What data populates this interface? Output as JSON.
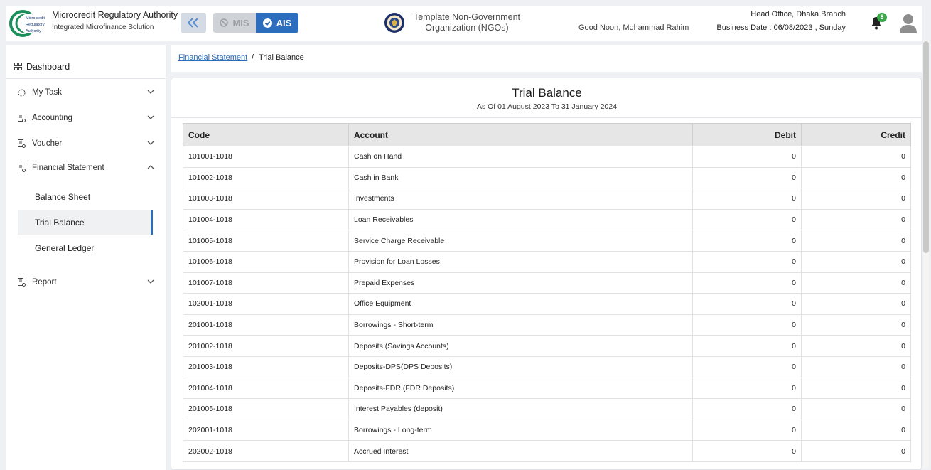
{
  "header": {
    "org_name": "Microcredit Regulatory Authority",
    "org_subtitle": "Integrated Microfinance Solution",
    "logo_text": [
      "Microcredit",
      "Regulatory",
      "Authority"
    ],
    "mis_label": "MIS",
    "ais_label": "AIS",
    "center_org": "Template Non-Government Organization (NGOs)",
    "greeting": "Good Noon, Mohammad Rahim",
    "branch": "Head Office, Dhaka Branch",
    "business_date": "Business Date : 06/08/2023 , Sunday",
    "notification_count": "8",
    "accent_color": "#2a6ebd",
    "badge_color": "#38a848"
  },
  "sidebar": {
    "dashboard": "Dashboard",
    "my_task": "My Task",
    "accounting": "Accounting",
    "voucher": "Voucher",
    "financial_statement": "Financial Statement",
    "balance_sheet": "Balance Sheet",
    "trial_balance": "Trial Balance",
    "general_ledger": "General Ledger",
    "report": "Report"
  },
  "breadcrumb": {
    "parent": "Financial Statement",
    "separator": "/",
    "current": "Trial Balance"
  },
  "report": {
    "title": "Trial Balance",
    "subtitle": "As Of 01 August 2023 To 31 January 2024",
    "columns": [
      "Code",
      "Account",
      "Debit",
      "Credit"
    ],
    "rows": [
      {
        "code": "101001-1018",
        "account": "Cash on Hand",
        "debit": "0",
        "credit": "0"
      },
      {
        "code": "101002-1018",
        "account": "Cash in Bank",
        "debit": "0",
        "credit": "0"
      },
      {
        "code": "101003-1018",
        "account": "Investments",
        "debit": "0",
        "credit": "0"
      },
      {
        "code": "101004-1018",
        "account": "Loan Receivables",
        "debit": "0",
        "credit": "0"
      },
      {
        "code": "101005-1018",
        "account": "Service Charge Receivable",
        "debit": "0",
        "credit": "0"
      },
      {
        "code": "101006-1018",
        "account": "Provision for Loan Losses",
        "debit": "0",
        "credit": "0"
      },
      {
        "code": "101007-1018",
        "account": "Prepaid Expenses",
        "debit": "0",
        "credit": "0"
      },
      {
        "code": "102001-1018",
        "account": "Office Equipment",
        "debit": "0",
        "credit": "0"
      },
      {
        "code": "201001-1018",
        "account": "Borrowings - Short-term",
        "debit": "0",
        "credit": "0"
      },
      {
        "code": "201002-1018",
        "account": "Deposits (Savings Accounts)",
        "debit": "0",
        "credit": "0"
      },
      {
        "code": "201003-1018",
        "account": "Deposits-DPS(DPS Deposits)",
        "debit": "0",
        "credit": "0"
      },
      {
        "code": "201004-1018",
        "account": "Deposits-FDR (FDR Deposits)",
        "debit": "0",
        "credit": "0"
      },
      {
        "code": "201005-1018",
        "account": "Interest Payables (deposit)",
        "debit": "0",
        "credit": "0"
      },
      {
        "code": "202001-1018",
        "account": "Borrowings - Long-term",
        "debit": "0",
        "credit": "0"
      },
      {
        "code": "202002-1018",
        "account": "Accrued Interest",
        "debit": "0",
        "credit": "0"
      }
    ]
  }
}
